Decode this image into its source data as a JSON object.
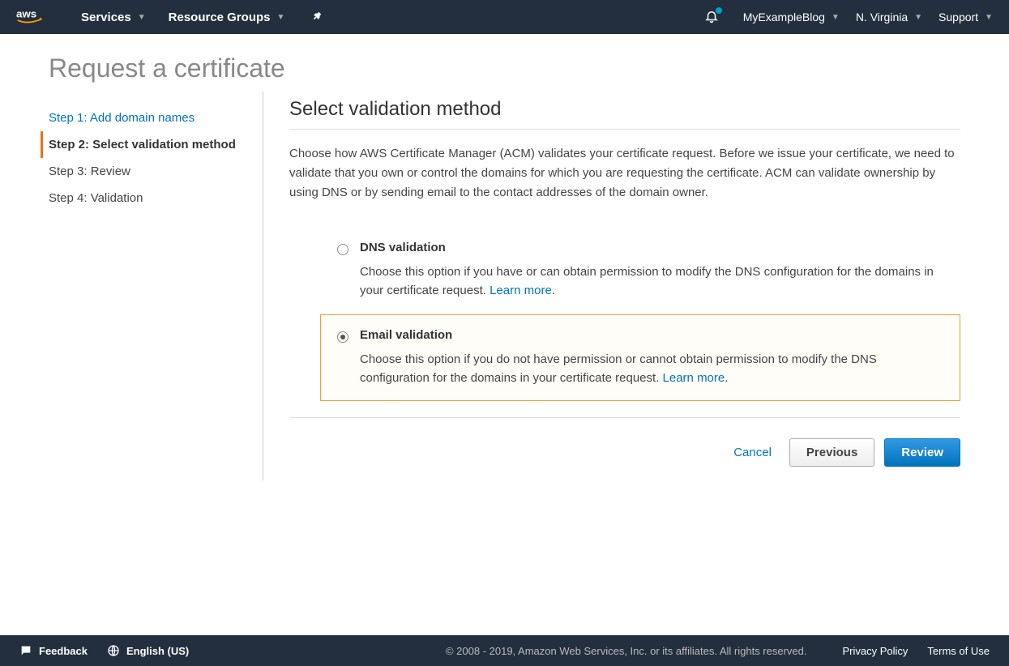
{
  "header": {
    "services": "Services",
    "resourceGroups": "Resource Groups",
    "account": "MyExampleBlog",
    "region": "N. Virginia",
    "support": "Support"
  },
  "pageTitle": "Request a certificate",
  "steps": [
    {
      "label": "Step 1: Add domain names",
      "state": "link"
    },
    {
      "label": "Step 2: Select validation method",
      "state": "active"
    },
    {
      "label": "Step 3: Review",
      "state": ""
    },
    {
      "label": "Step 4: Validation",
      "state": ""
    }
  ],
  "main": {
    "title": "Select validation method",
    "description": "Choose how AWS Certificate Manager (ACM) validates your certificate request. Before we issue your certificate, we need to validate that you own or control the domains for which you are requesting the certificate. ACM can validate ownership by using DNS or by sending email to the contact addresses of the domain owner.",
    "options": [
      {
        "title": "DNS validation",
        "desc": "Choose this option if you have or can obtain permission to modify the DNS configuration for the domains in your certificate request. ",
        "learnMore": "Learn more",
        "selected": false
      },
      {
        "title": "Email validation",
        "desc": "Choose this option if you do not have permission or cannot obtain permission to modify the DNS configuration for the domains in your certificate request. ",
        "learnMore": "Learn more",
        "selected": true
      }
    ]
  },
  "buttons": {
    "cancel": "Cancel",
    "previous": "Previous",
    "review": "Review"
  },
  "footer": {
    "feedback": "Feedback",
    "language": "English (US)",
    "copyright": "© 2008 - 2019, Amazon Web Services, Inc. or its affiliates. All rights reserved.",
    "privacy": "Privacy Policy",
    "terms": "Terms of Use"
  }
}
